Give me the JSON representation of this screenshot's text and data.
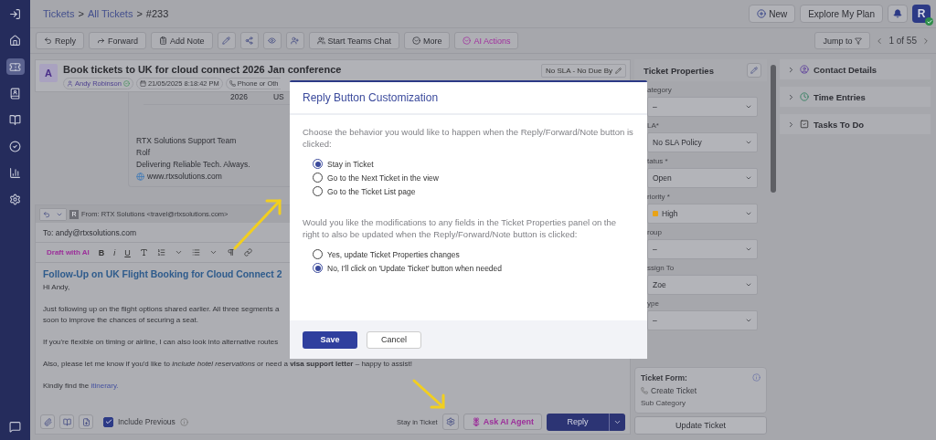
{
  "breadcrumb": [
    {
      "text": "Tickets",
      "kind": "link"
    },
    {
      "text": ">",
      "kind": "separator"
    },
    {
      "text": "All Tickets",
      "kind": "link"
    },
    {
      "text": ">",
      "kind": "separator"
    },
    {
      "text": "#233",
      "kind": "current"
    }
  ],
  "header_actions": {
    "new": "New",
    "plan": "Explore My Plan",
    "avatar": "R"
  },
  "toolbar": {
    "buttons": [
      {
        "label": "Reply",
        "kind": "plain"
      },
      {
        "label": "Forward",
        "kind": "plain"
      },
      {
        "label": "Add Note",
        "kind": "plain"
      },
      {
        "label": "Start Teams Chat",
        "kind": "plain"
      },
      {
        "label": "More",
        "kind": "plain"
      },
      {
        "label": "AI Actions",
        "kind": "ai"
      }
    ],
    "jump": "Jump to",
    "pager": "1 of 55"
  },
  "ticket": {
    "avatar": "A",
    "title": "Book tickets to UK for cloud connect 2026 Jan conference",
    "contact": "Andy Robinson",
    "date": "21/05/2025 8:18:42 PM",
    "channel": "Phone or Oth",
    "sla": "No SLA - No Due By"
  },
  "quoted": {
    "table_cells": [
      "2026",
      "US"
    ],
    "signature": [
      "RTX Solutions Support Team",
      "Rolf",
      "Delivering Reliable Tech. Always."
    ],
    "website": "www.rtxsolutions.com"
  },
  "composer": {
    "sender_badge": "R",
    "from": "From: RTX Solutions <travel@rtxsolutions.com>",
    "to": "To: andy@rtxsolutions.com",
    "draft_ai": "Draft with AI",
    "format_buttons": [
      "B",
      "i",
      "U"
    ],
    "heading": "Follow-Up on UK Flight Booking for Cloud Connect 2",
    "paragraphs": [
      [
        "Hi Andy,"
      ],
      [
        "Just following up on the flight options shared earlier. All three segments a",
        "soon to improve the chances of securing a seat."
      ],
      [
        "If you're flexible on timing or airline, I can also look into alternative routes"
      ],
      [
        "Also, please let me know if you'd like to *include hotel reservations* or need a **visa support letter** – happy to assist!"
      ]
    ],
    "closing": "Kindly find the",
    "closing_link": "itinerary.",
    "include_previous": {
      "label": "Include Previous",
      "checked": true
    },
    "stay_label": "Stay in Ticket",
    "ask_ai": "Ask AI Agent",
    "reply": "Reply"
  },
  "properties": {
    "title": "Ticket Properties",
    "fields": [
      {
        "label": "ategory",
        "value": "–"
      },
      {
        "label": "LA*",
        "value": "No SLA Policy"
      },
      {
        "label": "tatus *",
        "value": "Open"
      },
      {
        "label": "riority *",
        "value": "High",
        "color": "#e8a317"
      },
      {
        "label": "roup",
        "value": "–"
      },
      {
        "label": "ssign To",
        "value": "Zoe"
      },
      {
        "label": "ype",
        "value": "–"
      }
    ],
    "form_label": "Ticket Form:",
    "form_value": "Create Ticket",
    "sub_category": "Sub Category",
    "update": "Update Ticket"
  },
  "side_sections": [
    {
      "label": "Contact Details",
      "kind": "contact",
      "expanded": false
    },
    {
      "label": "Time Entries",
      "kind": "time",
      "expanded": false
    },
    {
      "label": "Tasks To Do",
      "kind": "tasks",
      "expanded": false
    }
  ],
  "modal": {
    "title": "Reply Button Customization",
    "question_1": "Choose the behavior you would like to happen when the Reply/Forward/Note button is clicked:",
    "options_1": [
      {
        "label": "Stay in Ticket",
        "selected": true
      },
      {
        "label": "Go to the Next Ticket in the view",
        "selected": false
      },
      {
        "label": "Go to the Ticket List page",
        "selected": false
      }
    ],
    "question_2": "Would you like the modifications to any fields in the Ticket Properties panel on the right to also be updated when the Reply/Forward/Note button is clicked:",
    "options_2": [
      {
        "label": "Yes, update Ticket Properties changes",
        "selected": false
      },
      {
        "label": "No, I'll click on 'Update Ticket' button when needed",
        "selected": true
      }
    ],
    "save": "Save",
    "cancel": "Cancel"
  }
}
